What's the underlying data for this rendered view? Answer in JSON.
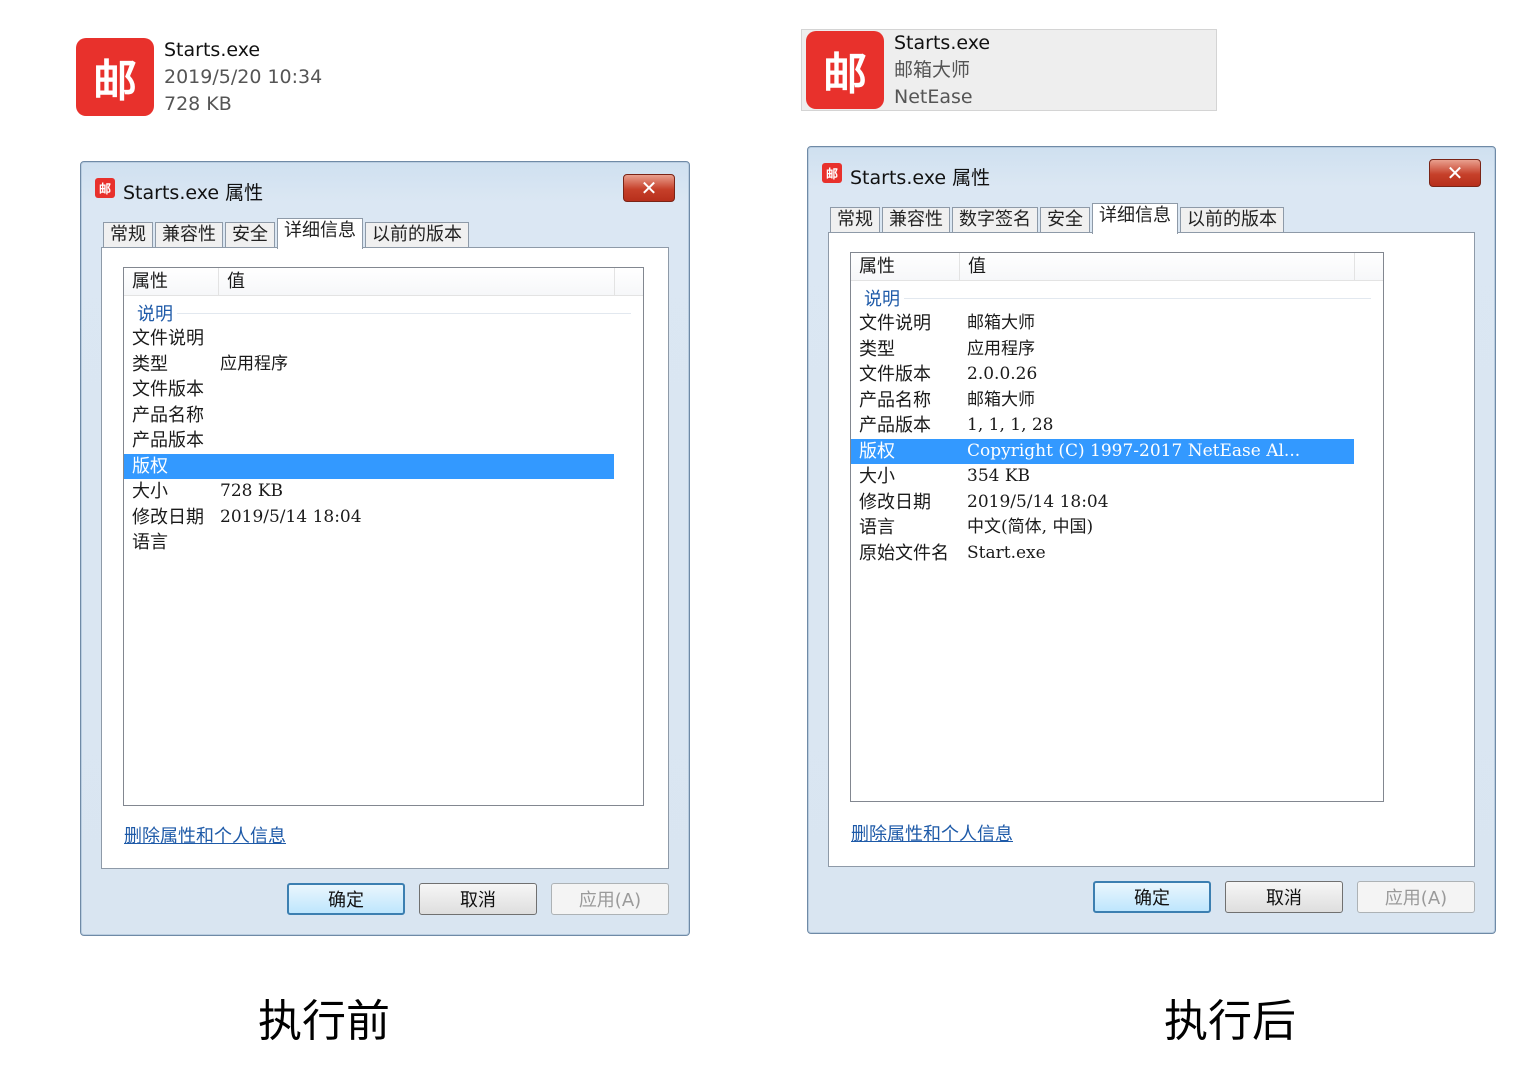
{
  "before": {
    "tile": {
      "icon_char": "邮",
      "name": "Starts.exe",
      "line2": "2019/5/20 10:34",
      "line3": "728 KB"
    },
    "dialog": {
      "title_icon_char": "邮",
      "title": "Starts.exe 属性",
      "close_glyph": "✕",
      "tabs": [
        {
          "label": "常规"
        },
        {
          "label": "兼容性"
        },
        {
          "label": "安全"
        },
        {
          "label": "详细信息",
          "active": true
        },
        {
          "label": "以前的版本"
        }
      ],
      "columns": {
        "property": "属性",
        "value": "值"
      },
      "group": "说明",
      "rows": [
        {
          "k": "文件说明",
          "v": ""
        },
        {
          "k": "类型",
          "v": "应用程序"
        },
        {
          "k": "文件版本",
          "v": ""
        },
        {
          "k": "产品名称",
          "v": ""
        },
        {
          "k": "产品版本",
          "v": ""
        },
        {
          "k": "版权",
          "v": "",
          "selected": true
        },
        {
          "k": "大小",
          "v": "728 KB"
        },
        {
          "k": "修改日期",
          "v": "2019/5/14 18:04"
        },
        {
          "k": "语言",
          "v": ""
        }
      ],
      "remove_link": "删除属性和个人信息",
      "buttons": {
        "ok": "确定",
        "cancel": "取消",
        "apply": "应用(A)"
      }
    },
    "caption": "执行前"
  },
  "after": {
    "tile": {
      "icon_char": "邮",
      "name": "Starts.exe",
      "line2": "邮箱大师",
      "line3": "NetEase"
    },
    "dialog": {
      "title_icon_char": "邮",
      "title": "Starts.exe 属性",
      "close_glyph": "✕",
      "tabs": [
        {
          "label": "常规"
        },
        {
          "label": "兼容性"
        },
        {
          "label": "数字签名"
        },
        {
          "label": "安全"
        },
        {
          "label": "详细信息",
          "active": true
        },
        {
          "label": "以前的版本"
        }
      ],
      "columns": {
        "property": "属性",
        "value": "值"
      },
      "group": "说明",
      "rows": [
        {
          "k": "文件说明",
          "v": "邮箱大师"
        },
        {
          "k": "类型",
          "v": "应用程序"
        },
        {
          "k": "文件版本",
          "v": "2.0.0.26"
        },
        {
          "k": "产品名称",
          "v": "邮箱大师"
        },
        {
          "k": "产品版本",
          "v": "1, 1, 1, 28"
        },
        {
          "k": "版权",
          "v": "Copyright (C) 1997-2017 NetEase Al...",
          "selected": true
        },
        {
          "k": "大小",
          "v": "354 KB"
        },
        {
          "k": "修改日期",
          "v": "2019/5/14 18:04"
        },
        {
          "k": "语言",
          "v": "中文(简体, 中国)"
        },
        {
          "k": "原始文件名",
          "v": "Start.exe"
        }
      ],
      "remove_link": "删除属性和个人信息",
      "buttons": {
        "ok": "确定",
        "cancel": "取消",
        "apply": "应用(A)"
      }
    },
    "caption": "执行后"
  },
  "colors": {
    "icon_red": "#e8312c",
    "selection": "#3399ff",
    "link": "#1e5aa8"
  }
}
